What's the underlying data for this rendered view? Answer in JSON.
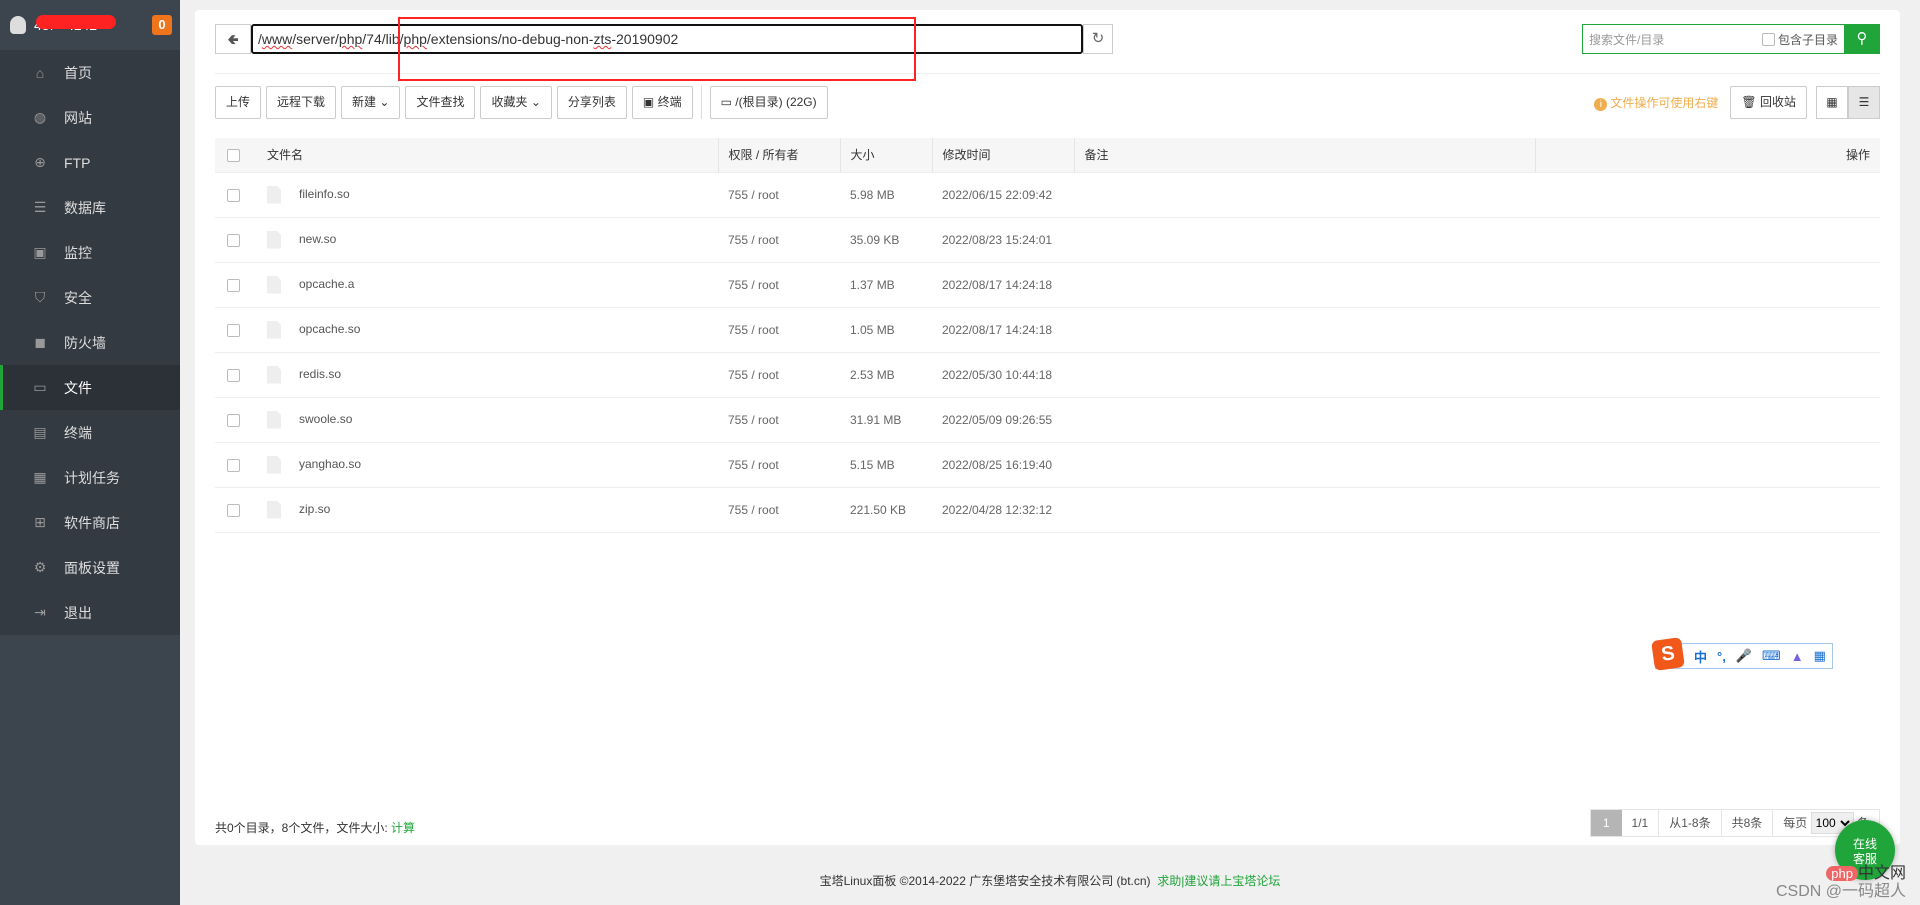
{
  "sidebar": {
    "server_ip": "43.***.142",
    "badge": "0",
    "items": [
      {
        "label": "首页",
        "icon": "home-icon"
      },
      {
        "label": "网站",
        "icon": "globe-icon"
      },
      {
        "label": "FTP",
        "icon": "ftp-icon"
      },
      {
        "label": "数据库",
        "icon": "database-icon"
      },
      {
        "label": "监控",
        "icon": "monitor-icon"
      },
      {
        "label": "安全",
        "icon": "shield-icon"
      },
      {
        "label": "防火墙",
        "icon": "firewall-icon"
      },
      {
        "label": "文件",
        "icon": "folder-icon"
      },
      {
        "label": "终端",
        "icon": "terminal-icon"
      },
      {
        "label": "计划任务",
        "icon": "calendar-icon"
      },
      {
        "label": "软件商店",
        "icon": "apps-icon"
      },
      {
        "label": "面板设置",
        "icon": "gear-icon"
      },
      {
        "label": "退出",
        "icon": "logout-icon"
      }
    ]
  },
  "path": {
    "segments": [
      "/",
      "www",
      "/server/",
      "php",
      "/74/lib/",
      "php",
      "/extensions/no-debug-non-",
      "zts",
      "-20190902"
    ]
  },
  "search": {
    "placeholder": "搜索文件/目录",
    "include_sub": "包含子目录"
  },
  "toolbar": {
    "upload": "上传",
    "remote_download": "远程下载",
    "new": "新建",
    "find": "文件查找",
    "favorites": "收藏夹",
    "share_list": "分享列表",
    "terminal": "终端",
    "disk": "/(根目录) (22G)",
    "tip": "文件操作可使用右键",
    "recycle": "回收站"
  },
  "table": {
    "headers": [
      "文件名",
      "权限 / 所有者",
      "大小",
      "修改时间",
      "备注",
      "操作"
    ],
    "rows": [
      {
        "name": "fileinfo.so",
        "perm": "755 / root",
        "size": "5.98 MB",
        "mtime": "2022/06/15 22:09:42"
      },
      {
        "name": "new.so",
        "perm": "755 / root",
        "size": "35.09 KB",
        "mtime": "2022/08/23 15:24:01"
      },
      {
        "name": "opcache.a",
        "perm": "755 / root",
        "size": "1.37 MB",
        "mtime": "2022/08/17 14:24:18"
      },
      {
        "name": "opcache.so",
        "perm": "755 / root",
        "size": "1.05 MB",
        "mtime": "2022/08/17 14:24:18"
      },
      {
        "name": "redis.so",
        "perm": "755 / root",
        "size": "2.53 MB",
        "mtime": "2022/05/30 10:44:18"
      },
      {
        "name": "swoole.so",
        "perm": "755 / root",
        "size": "31.91 MB",
        "mtime": "2022/05/09 09:26:55"
      },
      {
        "name": "yanghao.so",
        "perm": "755 / root",
        "size": "5.15 MB",
        "mtime": "2022/08/25 16:19:40"
      },
      {
        "name": "zip.so",
        "perm": "755 / root",
        "size": "221.50 KB",
        "mtime": "2022/04/28 12:32:12"
      }
    ]
  },
  "summary": {
    "text": "共0个目录，8个文件，文件大小: ",
    "calc": "计算"
  },
  "pager": {
    "current": "1",
    "pages": "1/1",
    "range": "从1-8条",
    "total": "共8条",
    "per_page_label": "每页",
    "per_page": "100",
    "unit": "条"
  },
  "ime": {
    "s": "S",
    "zh": "中",
    "punct": "°,"
  },
  "footer": {
    "copyright": "宝塔Linux面板 ©2014-2022 广东堡塔安全技术有限公司 (bt.cn)",
    "link": "求助|建议请上宝塔论坛"
  },
  "service": {
    "line1": "在线",
    "line2": "客服"
  },
  "watermark": {
    "php": "php",
    "cn": "中文网",
    "csdn": "CSDN @一码超人"
  }
}
